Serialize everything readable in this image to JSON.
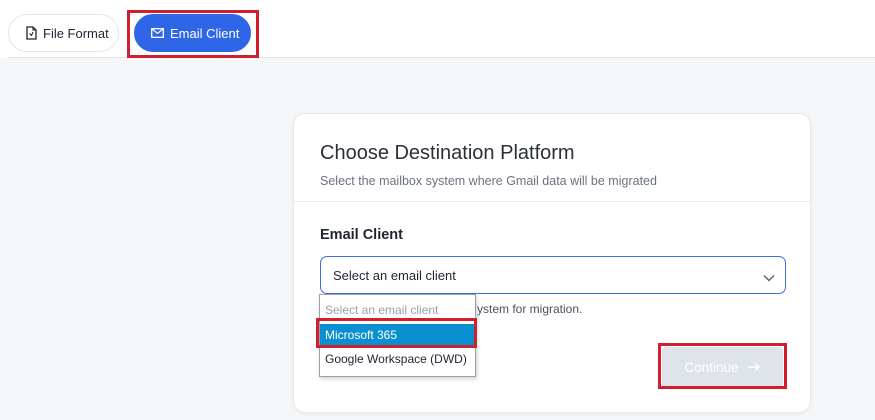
{
  "tabs": {
    "file_format": {
      "label": "File Format",
      "icon": "file-icon"
    },
    "email_client": {
      "label": "Email Client",
      "icon": "mail-icon",
      "active": true
    }
  },
  "card": {
    "title": "Choose Destination Platform",
    "subtitle": "Select the mailbox system where Gmail data will be migrated",
    "field_label": "Email Client",
    "select_value": "Select an email client",
    "helper_text": "ystem for migration.",
    "continue_label": "Continue",
    "continue_icon": "arrow-right-icon"
  },
  "dropdown": {
    "options": [
      {
        "label": "Select an email client",
        "placeholder": true
      },
      {
        "label": "Microsoft 365",
        "highlighted": true
      },
      {
        "label": "Google Workspace (DWD)"
      }
    ]
  },
  "colors": {
    "accent": "#2f66e7",
    "highlight_box": "#d0202e",
    "option_selected": "#0a8fd1",
    "button_disabled": "#dfe3ea"
  }
}
